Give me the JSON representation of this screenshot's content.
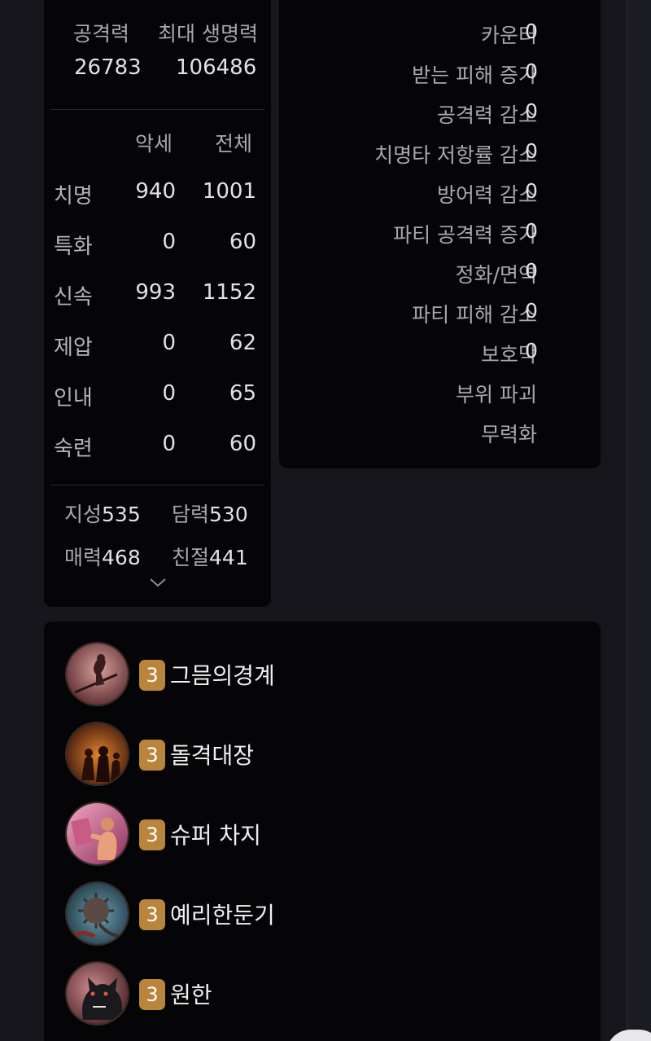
{
  "summary": {
    "attack_label": "공격력",
    "attack_value": "26783",
    "hp_label": "최대 생명력",
    "hp_value": "106486"
  },
  "combat_stats": {
    "col_accessory": "악세",
    "col_total": "전체",
    "rows": [
      {
        "name": "치명",
        "accessory": "940",
        "total": "1001"
      },
      {
        "name": "특화",
        "accessory": "0",
        "total": "60"
      },
      {
        "name": "신속",
        "accessory": "993",
        "total": "1152"
      },
      {
        "name": "제압",
        "accessory": "0",
        "total": "62"
      },
      {
        "name": "인내",
        "accessory": "0",
        "total": "65"
      },
      {
        "name": "숙련",
        "accessory": "0",
        "total": "60"
      }
    ]
  },
  "traits": [
    {
      "name": "지성",
      "value": "535"
    },
    {
      "name": "담력",
      "value": "530"
    },
    {
      "name": "매력",
      "value": "468"
    },
    {
      "name": "친절",
      "value": "441"
    }
  ],
  "expand_icon": "chevron-down-icon",
  "effects": [
    {
      "label": "카운터",
      "value": "0"
    },
    {
      "label": "받는 피해 증가",
      "value": "0"
    },
    {
      "label": "공격력 감소",
      "value": "0"
    },
    {
      "label": "치명타 저항률 감소",
      "value": "0"
    },
    {
      "label": "방어력 감소",
      "value": "0"
    },
    {
      "label": "파티 공격력 증가",
      "value": "0"
    },
    {
      "label": "정화/면역",
      "value": "0"
    },
    {
      "label": "파티 피해 감소",
      "value": "0"
    },
    {
      "label": "보호막",
      "value": "0"
    },
    {
      "label": "부위 파괴",
      "value": ""
    },
    {
      "label": "무력화",
      "value": ""
    }
  ],
  "engravings": [
    {
      "level": "3",
      "name": "그믐의경계",
      "icon": "witch-on-broom-icon"
    },
    {
      "level": "3",
      "name": "돌격대장",
      "icon": "burning-warriors-icon"
    },
    {
      "level": "3",
      "name": "슈퍼 차지",
      "icon": "charging-fighter-icon"
    },
    {
      "level": "3",
      "name": "예리한둔기",
      "icon": "spiked-mace-icon"
    },
    {
      "level": "3",
      "name": "원한",
      "icon": "snarling-wolf-icon"
    }
  ],
  "colors": {
    "background": "#16161c",
    "card": "#050507",
    "badge": "#b9843b",
    "muted_text": "#a8a8ae",
    "value_text": "#e2e2e6"
  }
}
